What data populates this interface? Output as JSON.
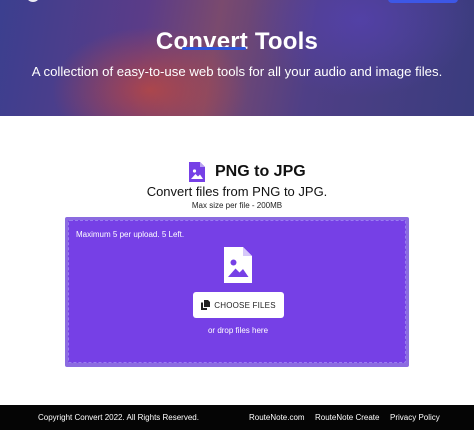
{
  "hero": {
    "title": "Convert Tools",
    "subtitle": "A collection of easy-to-use web tools for all your audio and image files."
  },
  "tool": {
    "title": "PNG to JPG",
    "description": "Convert files from PNG to JPG.",
    "max_size": "Max size per file - 200MB",
    "icon": "image-file-icon"
  },
  "dropzone": {
    "limit_text": "Maximum 5 per upload. 5 Left.",
    "choose_label": "CHOOSE FILES",
    "drop_hint": "or drop files here"
  },
  "footer": {
    "copyright": "Copyright Convert 2022. All Rights Reserved.",
    "links": [
      "RouteNote.com",
      "RouteNote Create",
      "Privacy Policy"
    ]
  },
  "colors": {
    "accent": "#7640e6",
    "underline": "#2f54d9",
    "footer_bg": "#050505"
  }
}
